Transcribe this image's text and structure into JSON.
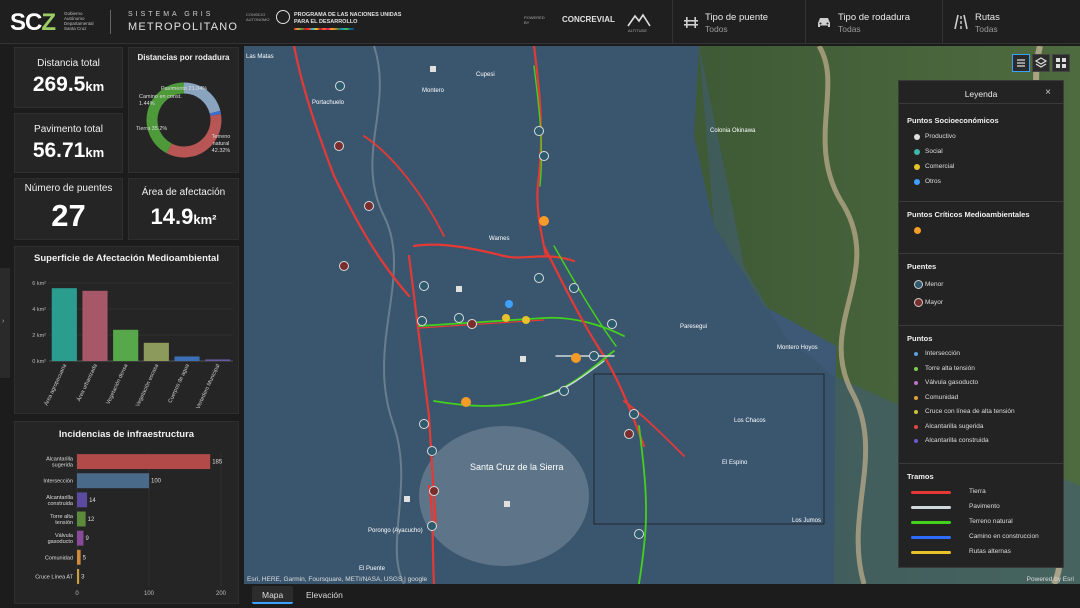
{
  "header": {
    "logo_text": "SCZ",
    "logo_sub": "Gobierno Autónomo Departamental Santa Cruz",
    "sistema_top": "SISTEMA GRIS",
    "sistema_bottom": "METROPOLITANO",
    "cobol": "CONSEJO AUTONOMO",
    "un_text_1": "PROGRAMA DE LAS NACIONES UNIDAS",
    "un_text_2": "PARA EL DESARROLLO",
    "powered_by": "POWERED BY",
    "concrevial": "CONCREVIAL",
    "altitude": "ALTITUDE",
    "filters": [
      {
        "label": "Tipo de puente",
        "value": "Todos",
        "icon": "bridge-icon"
      },
      {
        "label": "Tipo de rodadura",
        "value": "Todas",
        "icon": "car-icon"
      },
      {
        "label": "Rutas",
        "value": "Todas",
        "icon": "road-icon"
      }
    ]
  },
  "stats": {
    "distancia_total": {
      "label": "Distancia total",
      "value": "269.5",
      "unit": "km"
    },
    "pavimento_total": {
      "label": "Pavimento total",
      "value": "56.71",
      "unit": "km"
    },
    "numero_puentes": {
      "label": "Número de puentes",
      "value": "27"
    },
    "area_afectacion": {
      "label": "Área de afectación",
      "value": "14.9",
      "unit": "km²"
    }
  },
  "donut": {
    "title": "Distancias por rodadura",
    "labels": {
      "pavimento": "Pavimento 21.04%",
      "camino": "Camino en const. 1.44%",
      "tierra": "Tierra 35.2%",
      "terreno": "Terreno natural 42.32%"
    }
  },
  "chart_afectacion": {
    "title": "Superficie de Afectación Medioambiental",
    "type": "bar",
    "categories": [
      "Área agropecuaria",
      "Área urbanizada",
      "Vegetación densa",
      "Vegetación escasa",
      "Cuerpos de agua",
      "Vertedero Municipal"
    ],
    "values": [
      5.6,
      5.4,
      2.4,
      1.4,
      0.35,
      0.12
    ],
    "colors": [
      "#2a9d8f",
      "#a65868",
      "#57a84a",
      "#8c9a5b",
      "#3b6fb6",
      "#6a5aa6"
    ],
    "ylim": [
      0,
      6
    ],
    "yticks": [
      "6 km²",
      "4 km²",
      "2 km²",
      "0 km²"
    ]
  },
  "chart_incidencias": {
    "title": "Incidencias de infraestructura",
    "type": "bar",
    "categories": [
      "Alcantarilla sugerida",
      "Intersección",
      "Alcantarilla construida",
      "Torre alta tensión",
      "Válvula gasoducto",
      "Comunidad",
      "Cruce Línea AT"
    ],
    "values": [
      185,
      100,
      14,
      12,
      9,
      5,
      3
    ],
    "colors": [
      "#b24a4a",
      "#4a6a8a",
      "#5a4aa0",
      "#5a8a3a",
      "#8a4a9a",
      "#d08a3a",
      "#c8a040"
    ],
    "xlim": [
      0,
      200
    ],
    "xticks": [
      "0",
      "100",
      "200"
    ]
  },
  "chart_data": [
    {
      "type": "pie",
      "title": "Distancias por rodadura",
      "categories": [
        "Pavimento",
        "Camino en const.",
        "Tierra",
        "Terreno natural"
      ],
      "values": [
        21.04,
        1.44,
        35.2,
        42.32
      ]
    },
    {
      "type": "bar",
      "title": "Superficie de Afectación Medioambiental",
      "categories": [
        "Área agropecuaria",
        "Área urbanizada",
        "Vegetación densa",
        "Vegetación escasa",
        "Cuerpos de agua",
        "Vertedero Municipal"
      ],
      "values": [
        5.6,
        5.4,
        2.4,
        1.4,
        0.35,
        0.12
      ],
      "ylim": [
        0,
        6
      ]
    },
    {
      "type": "bar",
      "title": "Incidencias de infraestructura",
      "categories": [
        "Alcantarilla sugerida",
        "Intersección",
        "Alcantarilla construida",
        "Torre alta tensión",
        "Válvula gasoducto",
        "Comunidad",
        "Cruce Línea AT"
      ],
      "values": [
        185,
        100,
        14,
        12,
        9,
        5,
        3
      ],
      "xlim": [
        0,
        200
      ]
    }
  ],
  "legend": {
    "title": "Leyenda",
    "close": "×",
    "socio_head": "Puntos Socioeconómicos",
    "socio_items": [
      "Productivo",
      "Social",
      "Comercial",
      "Otros"
    ],
    "criticos_head": "Puntos Críticos Medioambientales",
    "puentes_head": "Puentes",
    "puentes_items": [
      "Menor",
      "Mayor"
    ],
    "puntos_head": "Puntos",
    "puntos_items": [
      "Intersección",
      "Torre alta tensión",
      "Válvula gasoducto",
      "Comunidad",
      "Cruce con línea de alta tensión",
      "Alcantarilla sugerida",
      "Alcantarilla construida"
    ],
    "tramos_head": "Tramos",
    "tramos_items": [
      "Tierra",
      "Pavimento",
      "Terreno natural",
      "Camino en construccion",
      "Rutas alternas"
    ],
    "tramos_colors": [
      "#e53935",
      "#cfd8dc",
      "#43d11b",
      "#2e6bff",
      "#e7c22a"
    ]
  },
  "map_labels": {
    "montero": "Montero",
    "cupesi": "Cupesi",
    "portachuelo": "Portachuelo",
    "warnes": "Warnes",
    "santa_cruz": "Santa Cruz de la Sierra",
    "los_chacos": "Los Chacos",
    "el_espino": "El Espino",
    "okinawa": "Colonia Okinawa",
    "paresegui": "Paresegui",
    "montero_hoyos": "Montero Hoyos",
    "los_jumos": "Los Jumos",
    "porongo": "Porongo (Ayacucho)",
    "el_puente": "El Puente",
    "las_matas": "Las Matas"
  },
  "attribution": "Esri, HERE, Garmin, Foursquare, METI/NASA, USGS | google",
  "powered_esri": "Powered by Esri",
  "tabs": [
    "Mapa",
    "Elevación"
  ]
}
